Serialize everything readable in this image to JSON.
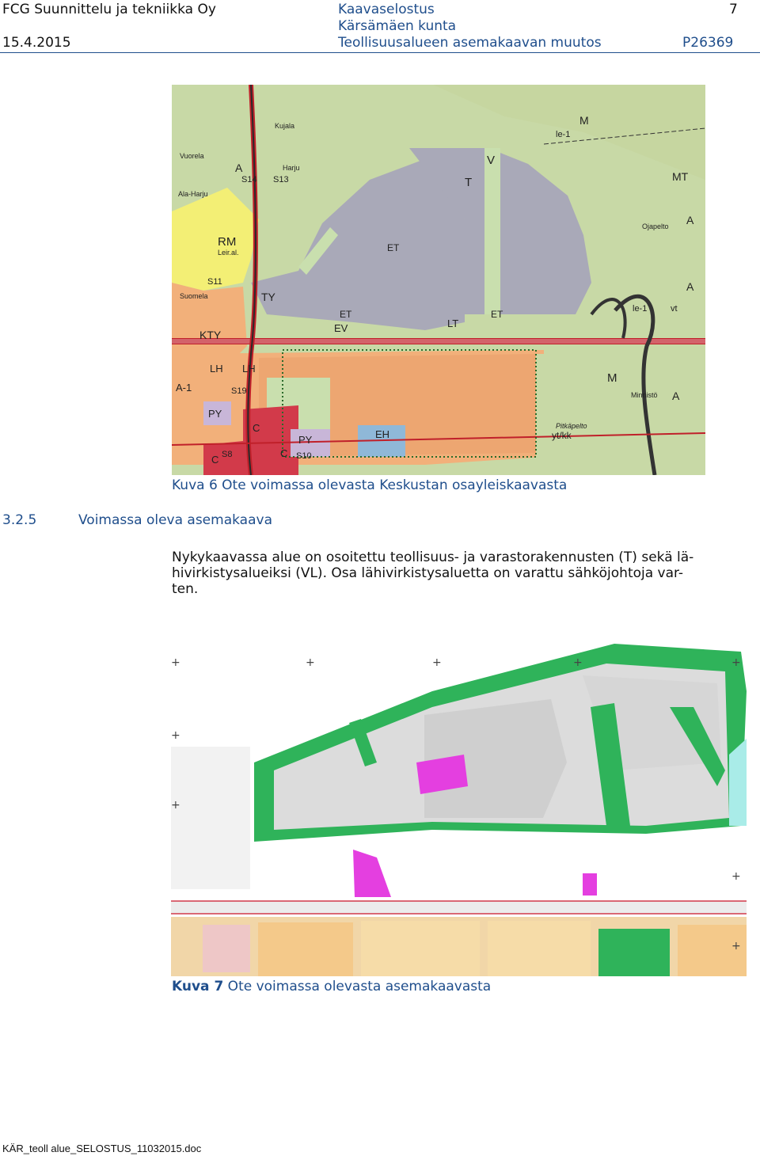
{
  "header": {
    "company": "FCG Suunnittelu ja tekniikka Oy",
    "date": "15.4.2015",
    "doc_type": "Kaavaselostus",
    "municipality": "Kärsämäen kunta",
    "project": "Teollisuusalueen asemakaavan muutos",
    "page_number": "7",
    "project_code": "P26369"
  },
  "figure1": {
    "caption": "Kuva 6 Ote voimassa olevasta Keskustan osayleiskaavasta",
    "labels": {
      "m": "M",
      "le1": "le-1",
      "le1b": "le-1",
      "mt": "MT",
      "a": "A",
      "a2": "A",
      "a3": "A",
      "a4": "A",
      "rm": "RM",
      "leir": "Leir.al.",
      "s11": "S11",
      "s14": "S14",
      "s13": "S13",
      "ty": "TY",
      "kty": "KTY",
      "lh": "LH",
      "lh2": "LH",
      "a1": "A-1",
      "py": "PY",
      "py2": "PY",
      "c": "C",
      "c2": "C",
      "c3": "C",
      "eh": "EH",
      "et": "ET",
      "et2": "ET",
      "et3": "ET",
      "ev": "EV",
      "lt": "LT",
      "t": "T",
      "v": "V",
      "s19": "S19",
      "s8": "S8",
      "s10": "S10",
      "m2": "M",
      "vt": "vt",
      "ytkk": "yt/kk",
      "pitkapelto": "Pitkäpelto",
      "minnisto": "Minnistö",
      "ojapelto": "Ojapelto",
      "vuorela": "Vuorela",
      "harju": "Harju",
      "alaharju": "Ala-Harju",
      "suomela": "Suomela",
      "kujala": "Kujala"
    }
  },
  "section": {
    "number": "3.2.5",
    "title": "Voimassa oleva asemakaava"
  },
  "paragraph": {
    "line1": "Nykykaavassa alue on osoitettu teollisuus- ja varastorakennusten (T) sekä lä-",
    "line2": "hivirkistysalueiksi (VL). Osa lähivirkistysaluetta on varattu sähköjohtoja var-",
    "line3": "ten."
  },
  "figure2": {
    "caption_bold": "Kuva 7",
    "caption_rest": " Ote voimassa olevasta asemakaavasta"
  },
  "footer": {
    "filename": "KÄR_teoll alue_SELOSTUS_11032015.doc"
  },
  "colors": {
    "header_blue": "#1f4e8c",
    "industrial_grey": "#a9a9b8",
    "green_zone": "#c9dfae",
    "orange_zone": "#f2b07a",
    "yellow_zone": "#f3ef75",
    "red_center": "#d23a4a",
    "park_green": "#2fb35a",
    "magenta": "#e43fe0"
  }
}
